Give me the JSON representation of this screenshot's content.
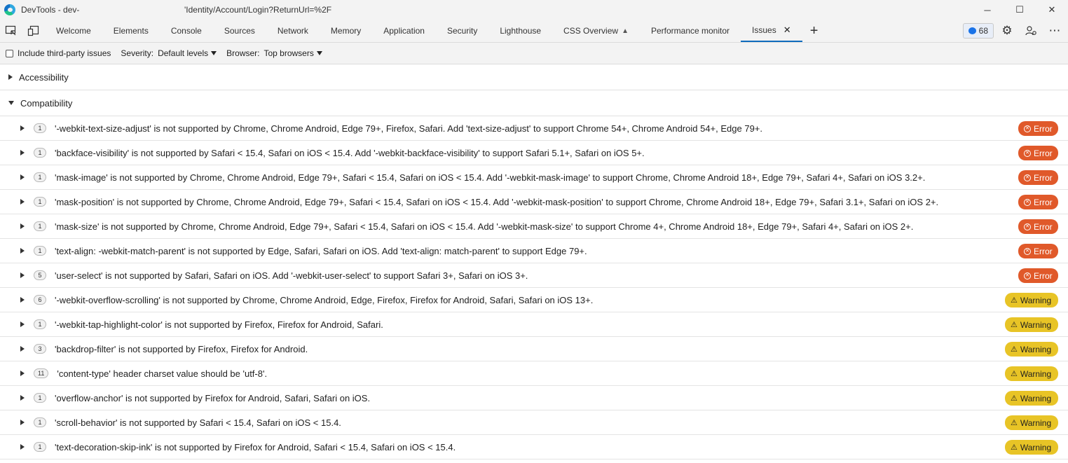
{
  "titlebar": {
    "title": "DevTools - dev-",
    "url": "'Identity/Account/Login?ReturnUrl=%2F",
    "minimize": "─",
    "maximize": "☐",
    "close": "✕"
  },
  "tabs": [
    {
      "label": "Welcome"
    },
    {
      "label": "Elements"
    },
    {
      "label": "Console"
    },
    {
      "label": "Sources"
    },
    {
      "label": "Network"
    },
    {
      "label": "Memory"
    },
    {
      "label": "Application"
    },
    {
      "label": "Security"
    },
    {
      "label": "Lighthouse"
    },
    {
      "label": "CSS Overview"
    },
    {
      "label": "Performance monitor"
    },
    {
      "label": "Issues"
    }
  ],
  "active_tab": "Issues",
  "toolbar": {
    "issue_count": "68",
    "add_tab": "+",
    "tab_close": "✕"
  },
  "filter": {
    "third_party_label": "Include third-party issues",
    "severity_label": "Severity:",
    "severity_value": "Default levels",
    "browser_label": "Browser:",
    "browser_value": "Top browsers"
  },
  "sections": {
    "accessibility": "Accessibility",
    "compatibility": "Compatibility"
  },
  "issues": [
    {
      "count": "1",
      "text": "'-webkit-text-size-adjust' is not supported by Chrome, Chrome Android, Edge 79+, Firefox, Safari. Add 'text-size-adjust' to support Chrome 54+, Chrome Android 54+, Edge 79+.",
      "severity": "Error"
    },
    {
      "count": "1",
      "text": "'backface-visibility' is not supported by Safari < 15.4, Safari on iOS < 15.4. Add '-webkit-backface-visibility' to support Safari 5.1+, Safari on iOS 5+.",
      "severity": "Error"
    },
    {
      "count": "1",
      "text": "'mask-image' is not supported by Chrome, Chrome Android, Edge 79+, Safari < 15.4, Safari on iOS < 15.4. Add '-webkit-mask-image' to support Chrome, Chrome Android 18+, Edge 79+, Safari 4+, Safari on iOS 3.2+.",
      "severity": "Error"
    },
    {
      "count": "1",
      "text": "'mask-position' is not supported by Chrome, Chrome Android, Edge 79+, Safari < 15.4, Safari on iOS < 15.4. Add '-webkit-mask-position' to support Chrome, Chrome Android 18+, Edge 79+, Safari 3.1+, Safari on iOS 2+.",
      "severity": "Error"
    },
    {
      "count": "1",
      "text": "'mask-size' is not supported by Chrome, Chrome Android, Edge 79+, Safari < 15.4, Safari on iOS < 15.4. Add '-webkit-mask-size' to support Chrome 4+, Chrome Android 18+, Edge 79+, Safari 4+, Safari on iOS 2+.",
      "severity": "Error"
    },
    {
      "count": "1",
      "text": "'text-align: -webkit-match-parent' is not supported by Edge, Safari, Safari on iOS. Add 'text-align: match-parent' to support Edge 79+.",
      "severity": "Error"
    },
    {
      "count": "5",
      "text": "'user-select' is not supported by Safari, Safari on iOS. Add '-webkit-user-select' to support Safari 3+, Safari on iOS 3+.",
      "severity": "Error"
    },
    {
      "count": "6",
      "text": "'-webkit-overflow-scrolling' is not supported by Chrome, Chrome Android, Edge, Firefox, Firefox for Android, Safari, Safari on iOS 13+.",
      "severity": "Warning"
    },
    {
      "count": "1",
      "text": "'-webkit-tap-highlight-color' is not supported by Firefox, Firefox for Android, Safari.",
      "severity": "Warning"
    },
    {
      "count": "3",
      "text": "'backdrop-filter' is not supported by Firefox, Firefox for Android.",
      "severity": "Warning"
    },
    {
      "count": "11",
      "text": "'content-type' header charset value should be 'utf-8'.",
      "severity": "Warning"
    },
    {
      "count": "1",
      "text": "'overflow-anchor' is not supported by Firefox for Android, Safari, Safari on iOS.",
      "severity": "Warning"
    },
    {
      "count": "1",
      "text": "'scroll-behavior' is not supported by Safari < 15.4, Safari on iOS < 15.4.",
      "severity": "Warning"
    },
    {
      "count": "1",
      "text": "'text-decoration-skip-ink' is not supported by Firefox for Android, Safari < 15.4, Safari on iOS < 15.4.",
      "severity": "Warning"
    }
  ],
  "colors": {
    "error": "#e0592a",
    "warning": "#e8c426",
    "accent": "#0f6cbd"
  }
}
